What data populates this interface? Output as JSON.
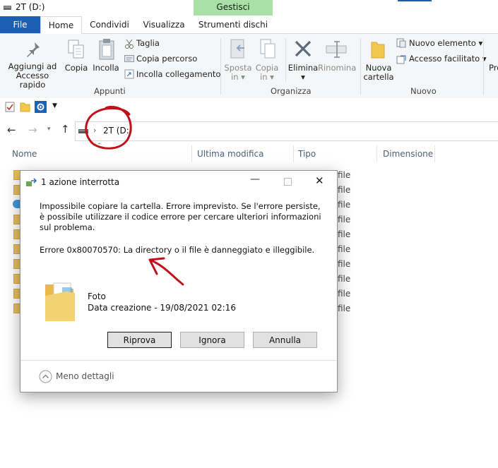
{
  "window": {
    "title": "2T (D:)"
  },
  "ribbon_tabs": {
    "file": "File",
    "home": "Home",
    "share": "Condividi",
    "view": "Visualizza",
    "context_header": "Gestisci",
    "drive_tools": "Strumenti dischi"
  },
  "ribbon": {
    "pin": "Aggiungi ad",
    "pin2": "Accesso rapido",
    "copy": "Copia",
    "paste": "Incolla",
    "cut": "Taglia",
    "copy_path": "Copia percorso",
    "paste_shortcut": "Incolla collegamento",
    "group_clipboard": "Appunti",
    "move": "Sposta",
    "move2": "in",
    "copyto": "Copia",
    "copyto2": "in",
    "delete": "Elimina",
    "rename": "Rinomina",
    "group_organize": "Organizza",
    "new_folder": "Nuova",
    "new_folder2": "cartella",
    "new_item": "Nuovo elemento",
    "easy_access": "Accesso facilitato",
    "group_new": "Nuovo",
    "properties_partial": "Pro"
  },
  "address": {
    "drive": "2T (D:)"
  },
  "columns": {
    "name": "Nome",
    "modified": "Ultima modifica",
    "type": "Tipo",
    "size": "Dimensione"
  },
  "rows_type": [
    "file",
    "file",
    "file",
    "file",
    "file",
    "file",
    "file",
    "file",
    "file",
    "file"
  ],
  "dialog": {
    "title": "1 azione interrotta",
    "message": "Impossibile copiare la cartella. Errore imprevisto. Se l'errore persiste, è possibile utilizzare il codice errore per cercare ulteriori informazioni sul problema.",
    "error": "Errore 0x80070570: La directory o il file è danneggiato e illeggibile.",
    "item_name": "Foto",
    "item_date": "Data creazione - 19/08/2021 02:16",
    "retry": "Riprova",
    "ignore": "Ignora",
    "cancel": "Annulla",
    "less_details": "Meno dettagli"
  },
  "colors": {
    "accent": "#1a5fb4",
    "context_tab": "#a8e0a6",
    "annotation": "#c0101a",
    "folder": "#f2c94c"
  }
}
